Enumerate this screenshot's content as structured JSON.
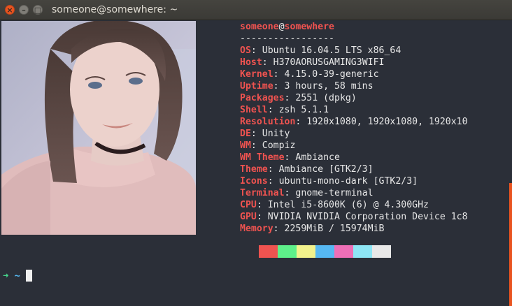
{
  "window": {
    "title": "someone@somewhere: ~",
    "close_glyph": "×",
    "minimize_glyph": "–",
    "maximize_glyph": "□"
  },
  "photo": {
    "icon": "portrait-photo"
  },
  "sysinfo": {
    "user": "someone",
    "at": "@",
    "host": "somewhere",
    "separator": "-----------------",
    "rows": [
      {
        "key": "OS",
        "value": "Ubuntu 16.04.5 LTS x86_64"
      },
      {
        "key": "Host",
        "value": "H370AORUSGAMING3WIFI"
      },
      {
        "key": "Kernel",
        "value": "4.15.0-39-generic"
      },
      {
        "key": "Uptime",
        "value": "3 hours, 58 mins"
      },
      {
        "key": "Packages",
        "value": "2551 (dpkg)"
      },
      {
        "key": "Shell",
        "value": "zsh 5.1.1"
      },
      {
        "key": "Resolution",
        "value": "1920x1080, 1920x1080, 1920x10"
      },
      {
        "key": "DE",
        "value": "Unity"
      },
      {
        "key": "WM",
        "value": "Compiz"
      },
      {
        "key": "WM Theme",
        "value": "Ambiance"
      },
      {
        "key": "Theme",
        "value": "Ambiance [GTK2/3]"
      },
      {
        "key": "Icons",
        "value": "ubuntu-mono-dark [GTK2/3]"
      },
      {
        "key": "Terminal",
        "value": "gnome-terminal"
      },
      {
        "key": "CPU",
        "value": "Intel i5-8600K (6) @ 4.300GHz"
      },
      {
        "key": "GPU",
        "value": "NVIDIA NVIDIA Corporation Device 1c8"
      },
      {
        "key": "Memory",
        "value": "2259MiB / 15974MiB"
      }
    ]
  },
  "palette": [
    "#ef5350",
    "#5ef08a",
    "#f2f28c",
    "#56b8f2",
    "#ee6fb7",
    "#8ee6f5",
    "#e8e8e8"
  ],
  "prompt": {
    "arrow": "➜",
    "dir": "~"
  },
  "colors": {
    "accent": "#ef5350",
    "background": "#2b2f38",
    "scrollbar": "#e95420"
  }
}
